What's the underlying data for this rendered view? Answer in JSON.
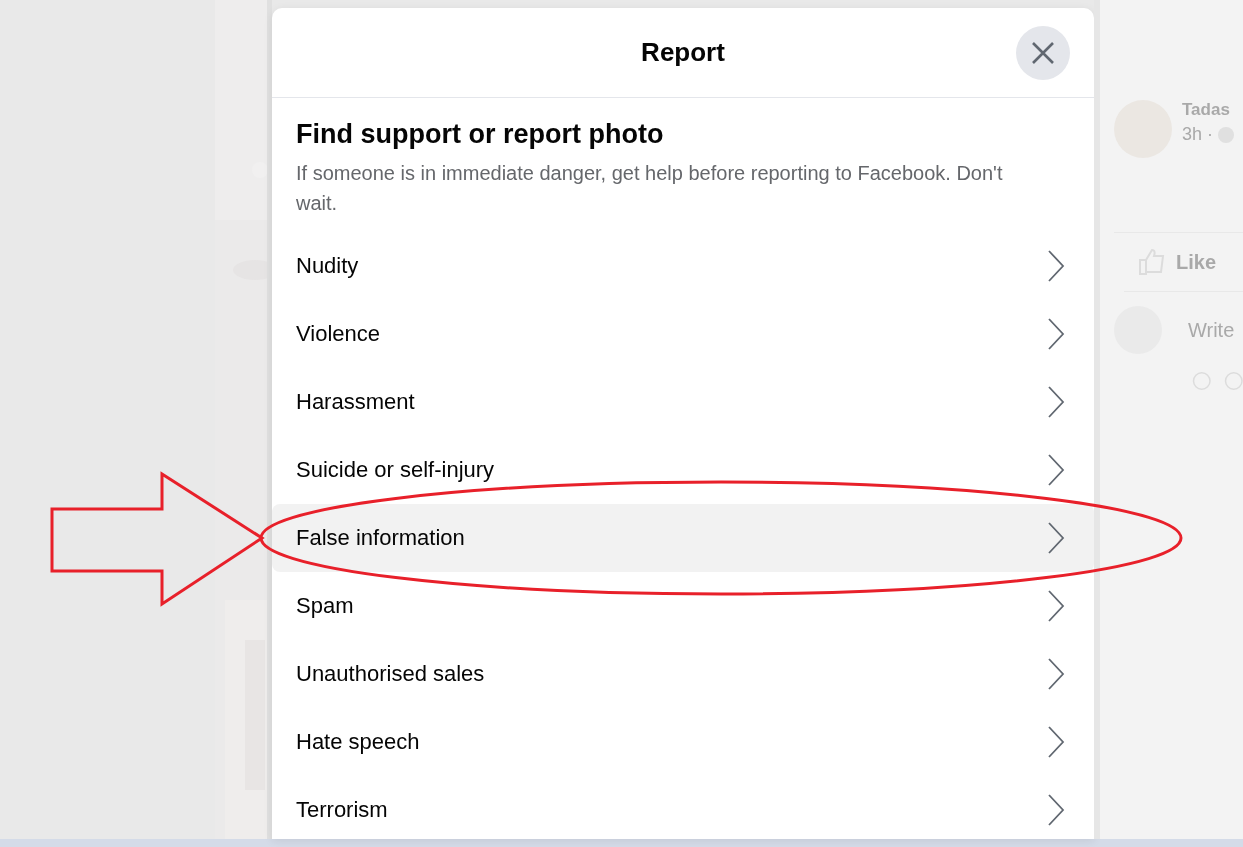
{
  "modal": {
    "title": "Report",
    "heading": "Find support or report photo",
    "description": "If someone is in immediate danger, get help before reporting to Facebook. Don't wait.",
    "options": [
      {
        "label": "Nudity",
        "selected": false
      },
      {
        "label": "Violence",
        "selected": false
      },
      {
        "label": "Harassment",
        "selected": false
      },
      {
        "label": "Suicide or self-injury",
        "selected": false
      },
      {
        "label": "False information",
        "selected": true
      },
      {
        "label": "Spam",
        "selected": false
      },
      {
        "label": "Unauthorised sales",
        "selected": false
      },
      {
        "label": "Hate speech",
        "selected": false
      },
      {
        "label": "Terrorism",
        "selected": false
      }
    ]
  },
  "background_post": {
    "author": "Tadas",
    "time": "3h ·",
    "like_label": "Like",
    "comment_placeholder": "Write"
  }
}
